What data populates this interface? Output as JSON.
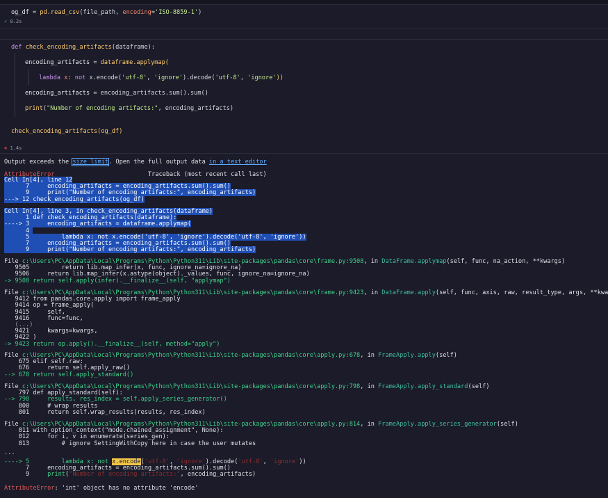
{
  "cell1": {
    "code_var": "og_df",
    "code_eq": " = ",
    "code_call": "pd.read_csv",
    "code_args_a": "(file_path, ",
    "code_kw": "encoding",
    "code_eq2": "=",
    "code_str": "'ISO-8859-1'",
    "code_close": ")",
    "time": "0.2s"
  },
  "cell2": {
    "l1_def": "def",
    "l1_name": "check_encoding_artifacts",
    "l1_rest": "(dataframe):",
    "l2_var": "encoding_artifacts",
    "l2_eq": " = ",
    "l2_call": "dataframe.applymap(",
    "l3_kw": "lambda",
    "l3_x": " x",
    "l3_colon": ": ",
    "l3_not": "not",
    "l3_rest": " x.encode(",
    "l3_s1": "'utf-8'",
    "l3_c1": ", ",
    "l3_s2": "'ignore'",
    "l3_m": ").decode(",
    "l3_s3": "'utf-8'",
    "l3_c2": ", ",
    "l3_s4": "'ignore'",
    "l3_end": "))",
    "l4_var": "encoding_artifacts",
    "l4_rest": " = encoding_artifacts.sum().sum()",
    "l5_print": "print",
    "l5_open": "(",
    "l5_str": "\"Number of encoding artifacts:\"",
    "l5_rest": ", encoding_artifacts)",
    "l6": "check_encoding_artifacts(og_df)",
    "time": "1.4s"
  },
  "output": {
    "limit_pre": "Output exceeds the ",
    "limit_link": "size limit",
    "limit_mid": ". Open the full output data ",
    "limit_link2": "in a text editor",
    "err_name": "AttributeError",
    "traceback_hdr": "Traceback (most recent call last)",
    "block1": [
      "Cell In[4], line 12",
      "      7     encoding_artifacts = encoding_artifacts.sum().sum()",
      "      9     print(\"Number of encoding artifacts:\", encoding_artifacts)",
      "---> 12 check_encoding_artifacts(og_df)"
    ],
    "block2": [
      "Cell In[4], line 3, in check_encoding_artifacts(dataframe)",
      "      1 def check_encoding_artifacts(dataframe):",
      "----> 3     encoding_artifacts = dataframe.applymap(",
      "      4 ",
      "      5         lambda x: not x.encode('utf-8', 'ignore').decode('utf-8', 'ignore'))",
      "      7     encoding_artifacts = encoding_artifacts.sum().sum()",
      "      9     print(\"Number of encoding artifacts:\", encoding_artifacts)"
    ],
    "frame1_hdr_a": "File ",
    "frame1_path": "c:\\Users\\PC\\AppData\\Local\\Programs\\Python\\Python311\\Lib\\site-packages\\pandas\\core\\frame.py:9508",
    "frame1_in": ", in ",
    "frame1_fn": "DataFrame.applymap",
    "frame1_sig": "(self, func, na_action, **kwargs)",
    "frame1_lines": [
      "   9505         return lib.map_infer(x, func, ignore_na=ignore_na)",
      "   9506     return lib.map_infer(x.astype(object)._values, func, ignore_na=ignore_na)",
      "-> 9508 return self.apply(infer).__finalize__(self, \"applymap\")"
    ],
    "frame2_path": "c:\\Users\\PC\\AppData\\Local\\Programs\\Python\\Python311\\Lib\\site-packages\\pandas\\core\\frame.py:9423",
    "frame2_fn": "DataFrame.apply",
    "frame2_sig": "(self, func, axis, raw, result_type, args, **kwargs)",
    "frame2_lines": [
      "   9412 from pandas.core.apply import frame_apply",
      "   9414 op = frame_apply(",
      "   9415     self,",
      "   9416     func=func,",
      "   (...)",
      "   9421     kwargs=kwargs,",
      "   9422 )",
      "-> 9423 return op.apply().__finalize__(self, method=\"apply\")"
    ],
    "frame3_path": "c:\\Users\\PC\\AppData\\Local\\Programs\\Python\\Python311\\Lib\\site-packages\\pandas\\core\\apply.py:678",
    "frame3_fn": "FrameApply.apply",
    "frame3_sig": "(self)",
    "frame3_lines": [
      "    675 elif self.raw:",
      "    676     return self.apply_raw()",
      "--> 678 return self.apply_standard()"
    ],
    "frame4_path": "c:\\Users\\PC\\AppData\\Local\\Programs\\Python\\Python311\\Lib\\site-packages\\pandas\\core\\apply.py:798",
    "frame4_fn": "FrameApply.apply_standard",
    "frame4_sig": "(self)",
    "frame4_lines": [
      "    797 def apply_standard(self):",
      "--> 798     results, res_index = self.apply_series_generator()",
      "    800     # wrap results",
      "    801     return self.wrap_results(results, res_index)"
    ],
    "frame5_path": "c:\\Users\\PC\\AppData\\Local\\Programs\\Python\\Python311\\Lib\\site-packages\\pandas\\core\\apply.py:814",
    "frame5_fn": "FrameApply.apply_series_generator",
    "frame5_sig": "(self)",
    "frame5_lines": [
      "    811 with option_context(\"mode.chained_assignment\", None):",
      "    812     for i, v in enumerate(series_gen):",
      "    813         # ignore SettingWithCopy here in case the user mutates"
    ],
    "ellipsis": "...",
    "last_arrow": "----> 5         lambda x: not ",
    "last_hl": "x.encode",
    "last_rest_a": "(",
    "last_s1": "'utf-8'",
    "last_c1": ", ",
    "last_s2": "'ignore'",
    "last_m": ").decode(",
    "last_s3": "'utf-8'",
    "last_c2": ", ",
    "last_s4": "'ignore'",
    "last_end": "))",
    "last_l7": "      7     encoding_artifacts = encoding_artifacts.sum().sum()",
    "last_l9_a": "      9     ",
    "last_l9_print": "print",
    "last_l9_open": "(",
    "last_l9_str": "\"Number of encoding artifacts:\"",
    "last_l9_rest": ", encoding_artifacts)",
    "final_err": "AttributeError",
    "final_msg": ": 'int' object has no attribute 'encode'"
  }
}
